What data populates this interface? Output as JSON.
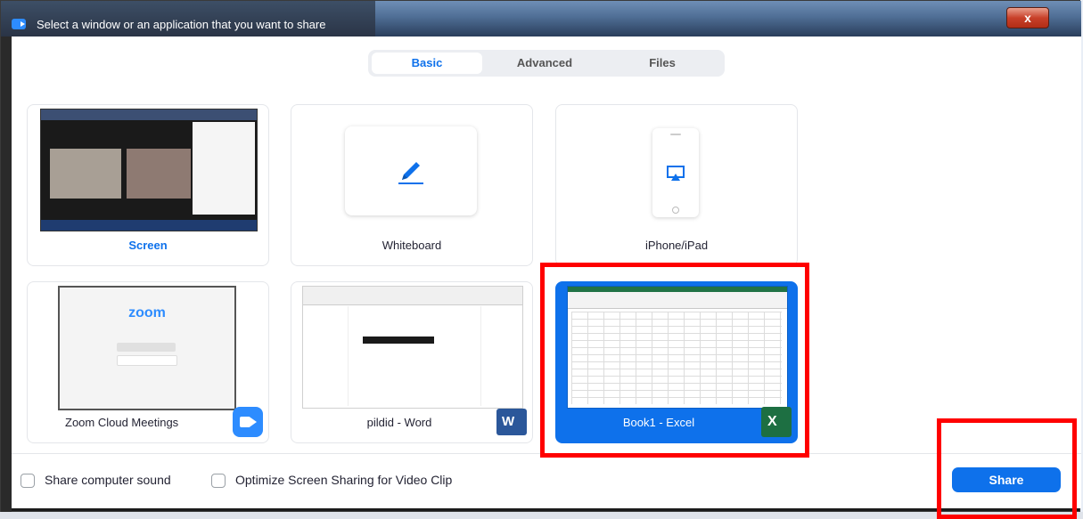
{
  "window": {
    "title": "Select a window or an application that you want to share",
    "close_label": "x"
  },
  "tabs": [
    {
      "label": "Basic",
      "active": true
    },
    {
      "label": "Advanced",
      "active": false
    },
    {
      "label": "Files",
      "active": false
    }
  ],
  "tiles": {
    "screen": {
      "label": "Screen",
      "selected": false
    },
    "whiteboard": {
      "label": "Whiteboard",
      "selected": false
    },
    "iphone": {
      "label": "iPhone/iPad",
      "selected": false
    },
    "zoom": {
      "label": "Zoom Cloud Meetings",
      "thumb_logo": "zoom",
      "selected": false
    },
    "word": {
      "label": "pildid - Word",
      "icon_letter": "W",
      "selected": false
    },
    "excel": {
      "label": "Book1 - Excel",
      "icon_letter": "X",
      "selected": true
    }
  },
  "options": {
    "share_sound": {
      "label": "Share computer sound",
      "checked": false
    },
    "optimize_video": {
      "label": "Optimize Screen Sharing for Video Clip",
      "checked": false
    }
  },
  "share_button": {
    "label": "Share"
  },
  "colors": {
    "accent": "#0e71eb",
    "highlight": "#ff0000",
    "excel_green": "#1d6f42",
    "word_blue": "#2b579a"
  }
}
